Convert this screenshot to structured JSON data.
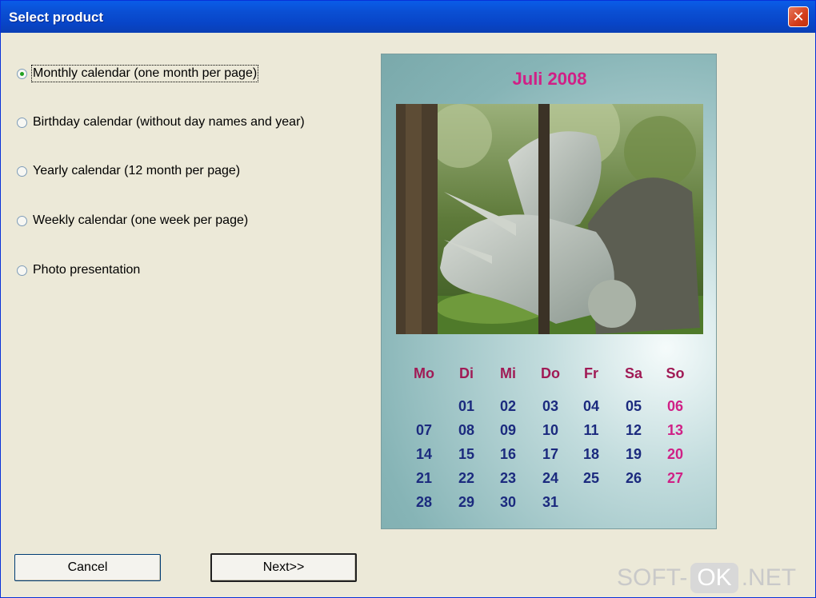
{
  "window": {
    "title": "Select product",
    "close_glyph": "✕"
  },
  "options": [
    {
      "label": "Monthly calendar (one month per page)",
      "checked": true
    },
    {
      "label": "Birthday calendar (without day names and year)",
      "checked": false
    },
    {
      "label": "Yearly calendar (12 month per page)",
      "checked": false
    },
    {
      "label": "Weekly calendar (one week per page)",
      "checked": false
    },
    {
      "label": "Photo presentation",
      "checked": false
    }
  ],
  "preview": {
    "month_title": "Juli 2008",
    "photo_icon": "triceratops-photo",
    "weekdays": [
      "Mo",
      "Di",
      "Mi",
      "Do",
      "Fr",
      "Sa",
      "So"
    ],
    "weeks": [
      [
        "",
        "01",
        "02",
        "03",
        "04",
        "05",
        "06"
      ],
      [
        "07",
        "08",
        "09",
        "10",
        "11",
        "12",
        "13"
      ],
      [
        "14",
        "15",
        "16",
        "17",
        "18",
        "19",
        "20"
      ],
      [
        "21",
        "22",
        "23",
        "24",
        "25",
        "26",
        "27"
      ],
      [
        "28",
        "29",
        "30",
        "31",
        "",
        "",
        ""
      ]
    ],
    "colors": {
      "title": "#d02086",
      "weekday": "#a01a55",
      "day": "#1b2a7e",
      "sunday": "#d02086"
    }
  },
  "buttons": {
    "cancel": "Cancel",
    "next": "Next>>"
  },
  "watermark": {
    "prefix": "SOFT-",
    "box": "OK",
    "suffix": ".NET"
  }
}
